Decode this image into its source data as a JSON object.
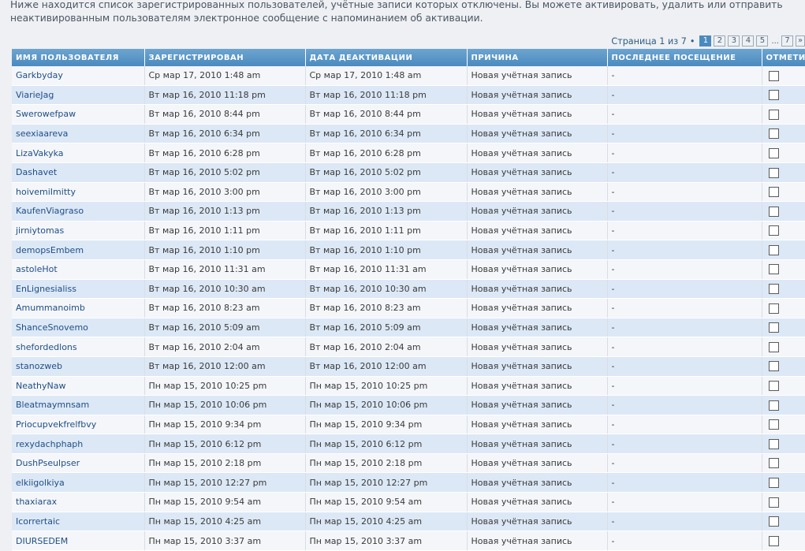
{
  "intro": "Ниже находится список зарегистрированных пользователей, учётные записи которых отключены. Вы можете активировать, удалить или отправить неактивированным пользователям электронное сообщение с напоминанием об активации.",
  "pagination": {
    "label": "Страница 1 из 7",
    "separator": "•",
    "pages": [
      "1",
      "2",
      "3",
      "4",
      "5"
    ],
    "active_page": "1",
    "ellipsis": "...",
    "last_page": "7",
    "next_arrow": "»"
  },
  "table": {
    "headers": {
      "username": "ИМЯ ПОЛЬЗОВАТЕЛЯ",
      "registered": "ЗАРЕГИСТРИРОВАН",
      "deactivated": "ДАТА ДЕАКТИВАЦИИ",
      "reason": "ПРИЧИНА",
      "last_visit": "ПОСЛЕДНЕЕ ПОСЕЩЕНИЕ",
      "mark": "ОТМЕТИТЬ"
    },
    "rows": [
      {
        "username": "Garkbyday",
        "registered": "Ср мар 17, 2010 1:48 am",
        "deactivated": "Ср мар 17, 2010 1:48 am",
        "reason": "Новая учётная запись",
        "last_visit": "-"
      },
      {
        "username": "ViarieJag",
        "registered": "Вт мар 16, 2010 11:18 pm",
        "deactivated": "Вт мар 16, 2010 11:18 pm",
        "reason": "Новая учётная запись",
        "last_visit": "-"
      },
      {
        "username": "Swerowefpaw",
        "registered": "Вт мар 16, 2010 8:44 pm",
        "deactivated": "Вт мар 16, 2010 8:44 pm",
        "reason": "Новая учётная запись",
        "last_visit": "-"
      },
      {
        "username": "seexiaareva",
        "registered": "Вт мар 16, 2010 6:34 pm",
        "deactivated": "Вт мар 16, 2010 6:34 pm",
        "reason": "Новая учётная запись",
        "last_visit": "-"
      },
      {
        "username": "LizaVakyka",
        "registered": "Вт мар 16, 2010 6:28 pm",
        "deactivated": "Вт мар 16, 2010 6:28 pm",
        "reason": "Новая учётная запись",
        "last_visit": "-"
      },
      {
        "username": "Dashavet",
        "registered": "Вт мар 16, 2010 5:02 pm",
        "deactivated": "Вт мар 16, 2010 5:02 pm",
        "reason": "Новая учётная запись",
        "last_visit": "-"
      },
      {
        "username": "hoivemiImitty",
        "registered": "Вт мар 16, 2010 3:00 pm",
        "deactivated": "Вт мар 16, 2010 3:00 pm",
        "reason": "Новая учётная запись",
        "last_visit": "-"
      },
      {
        "username": "KaufenViagraso",
        "registered": "Вт мар 16, 2010 1:13 pm",
        "deactivated": "Вт мар 16, 2010 1:13 pm",
        "reason": "Новая учётная запись",
        "last_visit": "-"
      },
      {
        "username": "jirniytomas",
        "registered": "Вт мар 16, 2010 1:11 pm",
        "deactivated": "Вт мар 16, 2010 1:11 pm",
        "reason": "Новая учётная запись",
        "last_visit": "-"
      },
      {
        "username": "demopsEmbem",
        "registered": "Вт мар 16, 2010 1:10 pm",
        "deactivated": "Вт мар 16, 2010 1:10 pm",
        "reason": "Новая учётная запись",
        "last_visit": "-"
      },
      {
        "username": "astoleHot",
        "registered": "Вт мар 16, 2010 11:31 am",
        "deactivated": "Вт мар 16, 2010 11:31 am",
        "reason": "Новая учётная запись",
        "last_visit": "-"
      },
      {
        "username": "EnLignesialiss",
        "registered": "Вт мар 16, 2010 10:30 am",
        "deactivated": "Вт мар 16, 2010 10:30 am",
        "reason": "Новая учётная запись",
        "last_visit": "-"
      },
      {
        "username": "Amummanoimb",
        "registered": "Вт мар 16, 2010 8:23 am",
        "deactivated": "Вт мар 16, 2010 8:23 am",
        "reason": "Новая учётная запись",
        "last_visit": "-"
      },
      {
        "username": "ShanceSnovemo",
        "registered": "Вт мар 16, 2010 5:09 am",
        "deactivated": "Вт мар 16, 2010 5:09 am",
        "reason": "Новая учётная запись",
        "last_visit": "-"
      },
      {
        "username": "shefordedlons",
        "registered": "Вт мар 16, 2010 2:04 am",
        "deactivated": "Вт мар 16, 2010 2:04 am",
        "reason": "Новая учётная запись",
        "last_visit": "-"
      },
      {
        "username": "stanozweb",
        "registered": "Вт мар 16, 2010 12:00 am",
        "deactivated": "Вт мар 16, 2010 12:00 am",
        "reason": "Новая учётная запись",
        "last_visit": "-"
      },
      {
        "username": "NeathyNaw",
        "registered": "Пн мар 15, 2010 10:25 pm",
        "deactivated": "Пн мар 15, 2010 10:25 pm",
        "reason": "Новая учётная запись",
        "last_visit": "-"
      },
      {
        "username": "Bleatmaymnsam",
        "registered": "Пн мар 15, 2010 10:06 pm",
        "deactivated": "Пн мар 15, 2010 10:06 pm",
        "reason": "Новая учётная запись",
        "last_visit": "-"
      },
      {
        "username": "Priocupvekfrelfbvy",
        "registered": "Пн мар 15, 2010 9:34 pm",
        "deactivated": "Пн мар 15, 2010 9:34 pm",
        "reason": "Новая учётная запись",
        "last_visit": "-"
      },
      {
        "username": "rexydachphaph",
        "registered": "Пн мар 15, 2010 6:12 pm",
        "deactivated": "Пн мар 15, 2010 6:12 pm",
        "reason": "Новая учётная запись",
        "last_visit": "-"
      },
      {
        "username": "DushPseulpser",
        "registered": "Пн мар 15, 2010 2:18 pm",
        "deactivated": "Пн мар 15, 2010 2:18 pm",
        "reason": "Новая учётная запись",
        "last_visit": "-"
      },
      {
        "username": "elkiigolkiya",
        "registered": "Пн мар 15, 2010 12:27 pm",
        "deactivated": "Пн мар 15, 2010 12:27 pm",
        "reason": "Новая учётная запись",
        "last_visit": "-"
      },
      {
        "username": "thaxiarax",
        "registered": "Пн мар 15, 2010 9:54 am",
        "deactivated": "Пн мар 15, 2010 9:54 am",
        "reason": "Новая учётная запись",
        "last_visit": "-"
      },
      {
        "username": "Icorrertaic",
        "registered": "Пн мар 15, 2010 4:25 am",
        "deactivated": "Пн мар 15, 2010 4:25 am",
        "reason": "Новая учётная запись",
        "last_visit": "-"
      },
      {
        "username": "DIURSEDEM",
        "registered": "Пн мар 15, 2010 3:37 am",
        "deactivated": "Пн мар 15, 2010 3:37 am",
        "reason": "Новая учётная запись",
        "last_visit": "-"
      }
    ]
  },
  "colors": {
    "header_bg": "#4a8ac0",
    "row_even": "#dce8f6",
    "row_odd": "#f4f6f9",
    "link": "#1f4e87"
  }
}
